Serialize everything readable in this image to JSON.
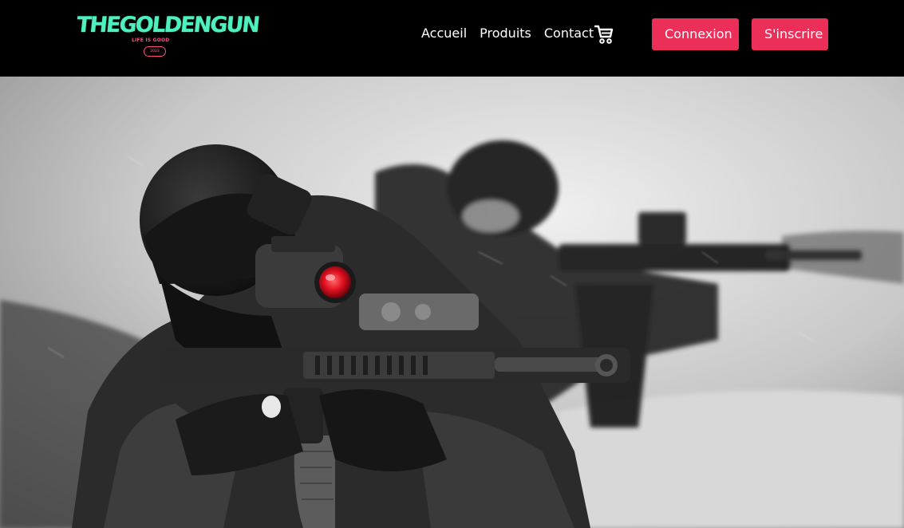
{
  "brand": {
    "title": "THEGOLDENGUN",
    "tagline": "LIFE IS GOOD",
    "year": "2023"
  },
  "nav": {
    "links": [
      "Accueil",
      "Produits",
      "Contact"
    ]
  },
  "actions": {
    "login_label": "Connexion",
    "signup_label": "S'inscrire"
  },
  "icons": {
    "cart": "shopping-cart-icon"
  },
  "colors": {
    "accent": "#eb2f59",
    "brand": "#4ff0c0",
    "brand_secondary": "#ff4b8b",
    "header_bg": "#000000",
    "optic_highlight": "#e01020"
  }
}
